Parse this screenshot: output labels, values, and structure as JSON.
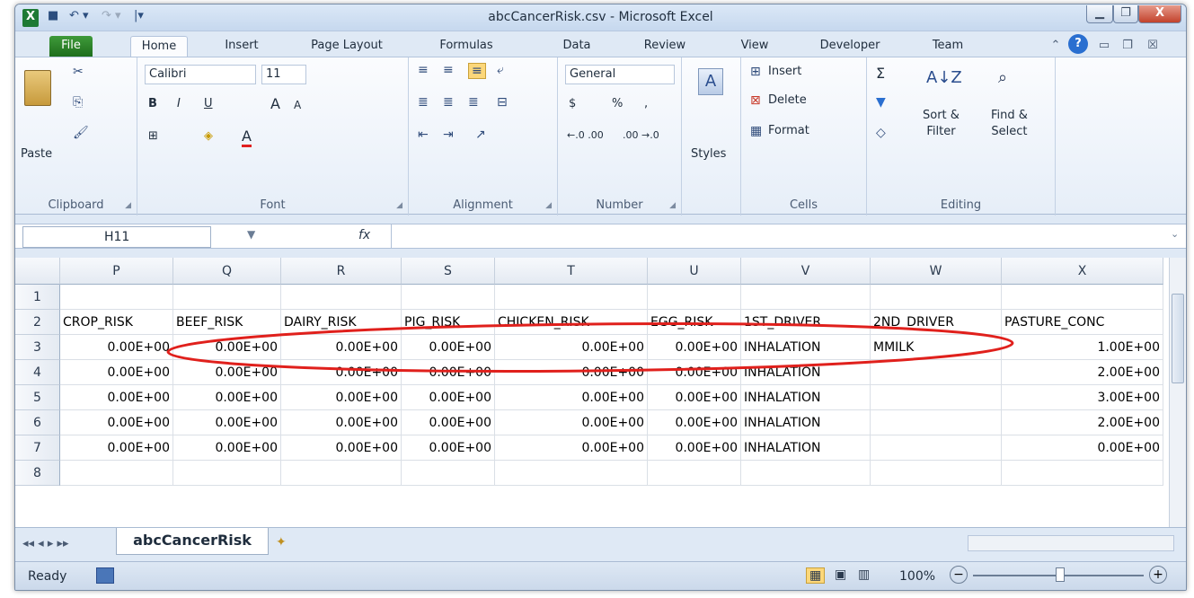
{
  "window": {
    "title": "abcCancerRisk.csv  -  Microsoft Excel",
    "minimize_glyph": "▁",
    "restore_glyph": "❐",
    "close_glyph": "X"
  },
  "qat": {
    "app_icon": "X",
    "save_glyph": "■",
    "undo_glyph": "↶ ▾",
    "redo_glyph": "↷ ▾",
    "customize_glyph": "|▾"
  },
  "tabs": [
    "File",
    "Home",
    "Insert",
    "Page Layout",
    "Formulas",
    "Data",
    "Review",
    "View",
    "Developer",
    "Team"
  ],
  "ribbon_right_icons": {
    "minimize_ribbon": "▭",
    "help": "?",
    "collapse": "⌃",
    "restore_workbook": "❐",
    "close_workbook": "☒"
  },
  "ribbon": {
    "clipboard": {
      "label": "Clipboard",
      "paste_label": "Paste"
    },
    "font": {
      "label": "Font",
      "font_name": "Calibri",
      "font_size": "11",
      "bold": "B",
      "italic": "I",
      "underline": "U",
      "grow": "A",
      "shrink": "A",
      "fill": "◈",
      "font_color": "A",
      "borders": "⊞"
    },
    "alignment": {
      "label": "Alignment"
    },
    "number": {
      "label": "Number",
      "format": "General",
      "currency": "$",
      "percent": "%",
      "comma": ",",
      "inc_decimal": "←.0 .00",
      "dec_decimal": ".00 →.0"
    },
    "styles": {
      "label": "Styles"
    },
    "cells": {
      "label": "Cells",
      "insert": "Insert",
      "delete": "Delete",
      "format": "Format"
    },
    "editing": {
      "label": "Editing",
      "sum": "Σ",
      "sort_line1": "Sort &",
      "sort_line2": "Filter",
      "find_line1": "Find &",
      "find_line2": "Select"
    }
  },
  "formula_bar": {
    "name_box": "H11",
    "fx": "fx",
    "formula": ""
  },
  "grid": {
    "columns": [
      "P",
      "Q",
      "R",
      "S",
      "T",
      "U",
      "V",
      "W",
      "X"
    ],
    "rows": [
      {
        "num": "1",
        "cells": [
          "",
          "",
          "",
          "",
          "",
          "",
          "",
          "",
          ""
        ]
      },
      {
        "num": "2",
        "cells": [
          "CROP_RISK",
          "BEEF_RISK",
          "DAIRY_RISK",
          "PIG_RISK",
          "CHICKEN_RISK",
          "EGG_RISK",
          "1ST_DRIVER",
          "2ND_DRIVER",
          "PASTURE_CONC"
        ]
      },
      {
        "num": "3",
        "cells": [
          "0.00E+00",
          "0.00E+00",
          "0.00E+00",
          "0.00E+00",
          "0.00E+00",
          "0.00E+00",
          "INHALATION",
          "MMILK",
          "1.00E+00"
        ]
      },
      {
        "num": "4",
        "cells": [
          "0.00E+00",
          "0.00E+00",
          "0.00E+00",
          "0.00E+00",
          "0.00E+00",
          "0.00E+00",
          "INHALATION",
          "",
          "2.00E+00"
        ]
      },
      {
        "num": "5",
        "cells": [
          "0.00E+00",
          "0.00E+00",
          "0.00E+00",
          "0.00E+00",
          "0.00E+00",
          "0.00E+00",
          "INHALATION",
          "",
          "3.00E+00"
        ]
      },
      {
        "num": "6",
        "cells": [
          "0.00E+00",
          "0.00E+00",
          "0.00E+00",
          "0.00E+00",
          "0.00E+00",
          "0.00E+00",
          "INHALATION",
          "",
          "2.00E+00"
        ]
      },
      {
        "num": "7",
        "cells": [
          "0.00E+00",
          "0.00E+00",
          "0.00E+00",
          "0.00E+00",
          "0.00E+00",
          "0.00E+00",
          "INHALATION",
          "",
          "0.00E+00"
        ]
      },
      {
        "num": "8",
        "cells": [
          "",
          "",
          "",
          "",
          "",
          "",
          "",
          "",
          ""
        ]
      }
    ],
    "annotation_color": "#e0201c"
  },
  "sheets": {
    "active": "abcCancerRisk",
    "nav_glyphs": "◂◂  ◂  ▸  ▸▸"
  },
  "status": {
    "ready": "Ready",
    "zoom": "100%",
    "zoom_out": "−",
    "zoom_in": "+"
  }
}
